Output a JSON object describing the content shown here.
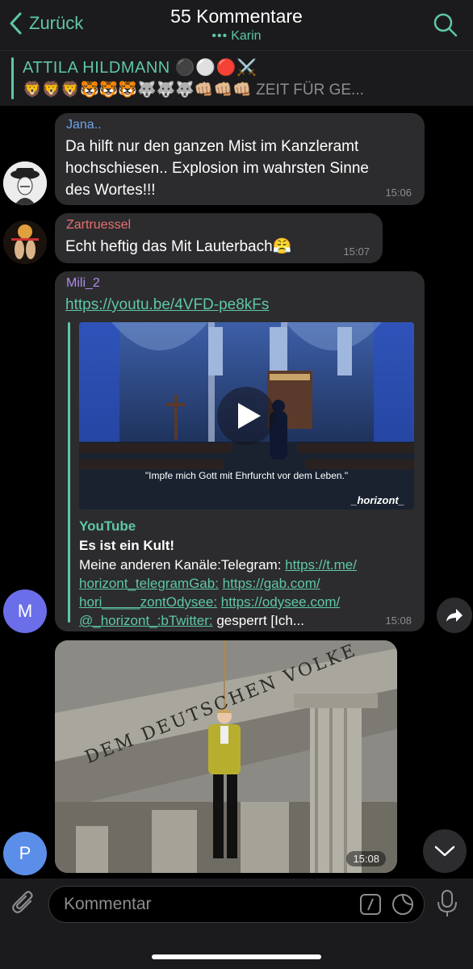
{
  "header": {
    "back_label": "Zurück",
    "title": "55 Kommentare",
    "subtitle": "Karin",
    "subtitle_dots": "•••"
  },
  "pinned": {
    "name": "ATTILA HILDMANN ⚫️⚪️🔴⚔️",
    "text": "🦁🦁🦁🐯🐯🐯🐺🐺🐺👊🏼👊🏼👊🏼 ZEIT FÜR GE..."
  },
  "messages": [
    {
      "sender": "Jana..",
      "sender_color": "#6fa3e8",
      "lines": [
        "Da hilft nur den ganzen Mist im Kanzleramt",
        "hochschiesen.. Explosion im wahrsten Sinne",
        "des Wortes!!!"
      ],
      "time": "15:06"
    },
    {
      "sender": "Zartruessel",
      "sender_color": "#e8706f",
      "text": "Echt heftig das Mit Lauterbach😤",
      "time": "15:07"
    },
    {
      "sender": "Mili_2",
      "sender_color": "#b08be8",
      "avatar_letter": "M",
      "link": "https://youtu.be/4VFD-pe8kFs",
      "video_caption": "\"Impfe mich Gott mit Ehrfurcht vor dem Leben.\"",
      "video_watermark": "_horizont_",
      "preview_site": "YouTube",
      "preview_title": "Es ist ein Kult!",
      "desc_line1_plain": "Meine anderen Kanäle:Telegram: ",
      "desc_line1_link": "https://t.me/",
      "desc_line2_link1": "horizont_telegramGab:",
      "desc_line2_link2": "https://gab.com/",
      "desc_line3_link1": "hori_____zontOdysee:",
      "desc_line3_link2": "https://odysee.com/",
      "desc_line4_link": "@_horizont_:bTwitter:",
      "desc_line4_plain": " gesperrt [Ich...",
      "time": "15:08"
    },
    {
      "avatar_letter": "P",
      "image_inscription": "DEM DEUTSCHEN VOLKE",
      "time": "15:08"
    }
  ],
  "composer": {
    "placeholder": "Kommentar"
  },
  "colors": {
    "accent": "#5fc7a6",
    "bubble": "#2c2c2e",
    "bar": "#1b1b1d"
  }
}
